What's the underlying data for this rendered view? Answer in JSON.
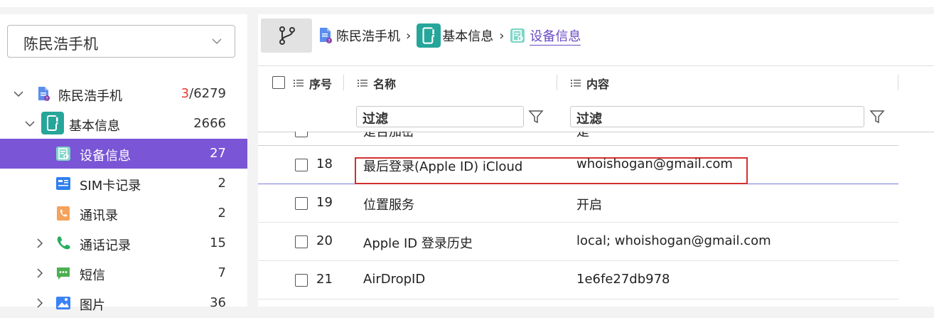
{
  "device_selector": {
    "value": "陈民浩手机"
  },
  "tree": [
    {
      "label": "陈民浩手机",
      "count_red": "3",
      "count_rest": "/6279",
      "icon": "phone-file-icon",
      "expanded": true
    },
    {
      "label": "基本信息",
      "count": "2666",
      "icon": "basic-info-icon",
      "expanded": true
    },
    {
      "label": "设备信息",
      "count": "27",
      "icon": "device-info-icon",
      "selected": true
    },
    {
      "label": "SIM卡记录",
      "count": "2",
      "icon": "sim-card-icon"
    },
    {
      "label": "通讯录",
      "count": "2",
      "icon": "contacts-icon"
    },
    {
      "label": "通话记录",
      "count": "15",
      "icon": "phone-call-icon",
      "collapsed": true
    },
    {
      "label": "短信",
      "count": "7",
      "icon": "sms-icon",
      "collapsed": true
    },
    {
      "label": "图片",
      "count": "36",
      "icon": "image-icon",
      "collapsed": true
    }
  ],
  "breadcrumb": {
    "item1": "陈民浩手机",
    "item2": "基本信息",
    "item3": "设备信息"
  },
  "table": {
    "headers": {
      "index": "序号",
      "name": "名称",
      "content": "内容"
    },
    "filter_name": "过滤",
    "filter_content": "过滤",
    "partial_row": {
      "name": "是否加密",
      "value": "是"
    },
    "rows": [
      {
        "num": "18",
        "name": "最后登录(Apple ID) iCloud",
        "value": "whoishogan@gmail.com",
        "highlighted": true
      },
      {
        "num": "19",
        "name": "位置服务",
        "value": "开启"
      },
      {
        "num": "20",
        "name": "Apple ID 登录历史",
        "value": "local; whoishogan@gmail.com"
      },
      {
        "num": "21",
        "name": "AirDropID",
        "value": "1e6fe27db978"
      }
    ]
  },
  "colors": {
    "accent": "#7a55d6",
    "highlight": "#d32f2f",
    "teal": "#2aa198"
  }
}
